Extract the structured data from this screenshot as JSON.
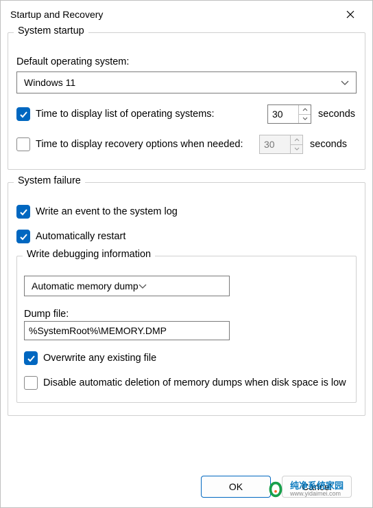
{
  "window": {
    "title": "Startup and Recovery"
  },
  "startup": {
    "group_title": "System startup",
    "default_os_label": "Default operating system:",
    "default_os_value": "Windows 11",
    "time_list_label": "Time to display list of operating systems:",
    "time_list_checked": true,
    "time_list_value": "30",
    "time_recovery_label": "Time to display recovery options when needed:",
    "time_recovery_checked": false,
    "time_recovery_value": "30",
    "seconds_label": "seconds"
  },
  "failure": {
    "group_title": "System failure",
    "write_event_label": "Write an event to the system log",
    "write_event_checked": true,
    "auto_restart_label": "Automatically restart",
    "auto_restart_checked": true,
    "debug_group_title": "Write debugging information",
    "debug_type": "Automatic memory dump",
    "dump_file_label": "Dump file:",
    "dump_file_value": "%SystemRoot%\\MEMORY.DMP",
    "overwrite_label": "Overwrite any existing file",
    "overwrite_checked": true,
    "disable_auto_delete_label": "Disable automatic deletion of memory dumps when disk space is low",
    "disable_auto_delete_checked": false
  },
  "buttons": {
    "ok": "OK",
    "cancel": "Cancel"
  },
  "watermark": {
    "text": "纯净系统家园",
    "url": "www.yidaimei.com"
  }
}
